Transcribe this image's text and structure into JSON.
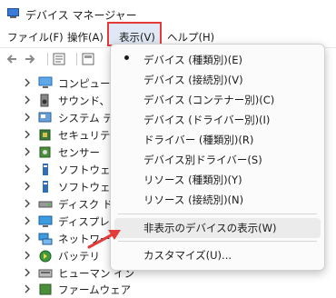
{
  "window": {
    "title": "デバイス マネージャー"
  },
  "menubar": {
    "file": "ファイル(F)",
    "action": "操作(A)",
    "view": "表示(V)",
    "help": "ヘルプ(H)"
  },
  "tree": {
    "items": [
      {
        "label": "コンピューター",
        "icon": "computer-icon"
      },
      {
        "label": "サウンド、ビデ",
        "icon": "speaker-icon"
      },
      {
        "label": "システム デバ",
        "icon": "system-device-icon"
      },
      {
        "label": "セキュリティデ",
        "icon": "security-device-icon"
      },
      {
        "label": "センサー",
        "icon": "sensor-icon"
      },
      {
        "label": "ソフトウェア コ",
        "icon": "software-component-icon"
      },
      {
        "label": "ソフトウェア デ",
        "icon": "software-device-icon"
      },
      {
        "label": "ディスク ドライ",
        "icon": "disk-drive-icon"
      },
      {
        "label": "ディスプレイ ア",
        "icon": "display-adapter-icon"
      },
      {
        "label": "ネットワーク ア",
        "icon": "network-adapter-icon"
      },
      {
        "label": "バッテリ",
        "icon": "battery-icon"
      },
      {
        "label": "ヒューマン イン",
        "icon": "hid-icon"
      },
      {
        "label": "ファームウェア",
        "icon": "firmware-icon"
      }
    ]
  },
  "view_menu": {
    "items": [
      {
        "label": "デバイス (種類別)(E)",
        "checked": true
      },
      {
        "label": "デバイス (接続別)(V)"
      },
      {
        "label": "デバイス (コンテナー別)(C)"
      },
      {
        "label": "デバイス (ドライバー別)(I)"
      },
      {
        "label": "ドライバー (種類別)(R)"
      },
      {
        "label": "デバイス別ドライバー(S)"
      },
      {
        "label": "リソース (種類別)(Y)"
      },
      {
        "label": "リソース (接続別)(N)"
      }
    ],
    "show_hidden": "非表示のデバイスの表示(W)",
    "customize": "カスタマイズ(U)..."
  },
  "colors": {
    "highlight_box": "#e33b3b",
    "arrow": "#e33b3b"
  }
}
